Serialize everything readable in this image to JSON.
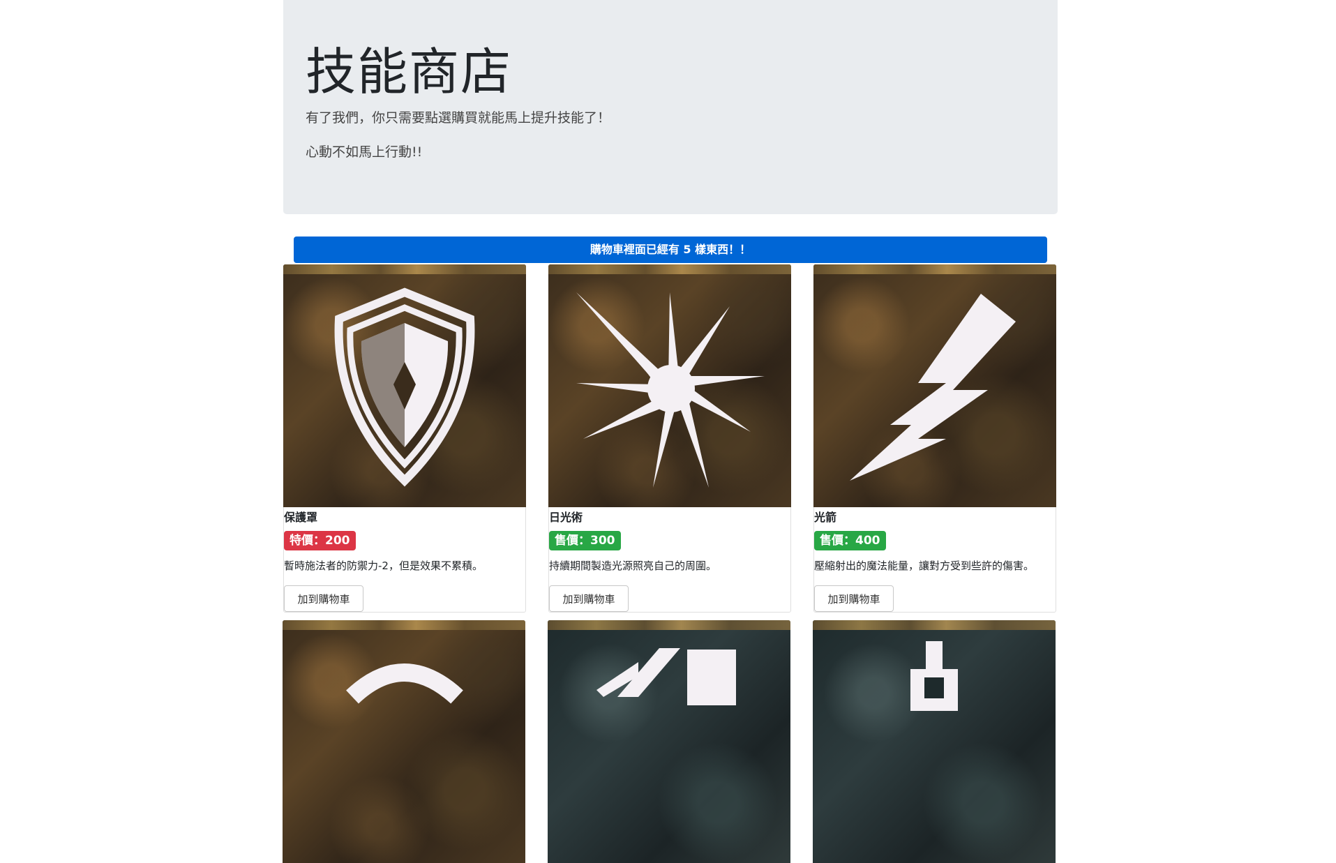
{
  "jumbotron": {
    "title": "技能商店",
    "lead1": "有了我們，你只需要點選購買就能馬上提升技能了！",
    "lead2": "心動不如馬上行動!!"
  },
  "cart_alert": "購物車裡面已經有 5 樣東西！！",
  "products": [
    {
      "name": "保護罩",
      "price_label": "特價：200",
      "price_style": "danger",
      "description": "暫時施法者的防禦力-2，但是效果不累積。",
      "button": "加到購物車",
      "icon": "shield-icon"
    },
    {
      "name": "日光術",
      "price_label": "售價：300",
      "price_style": "success",
      "description": "持續期間製造光源照亮自己的周圍。",
      "button": "加到購物車",
      "icon": "light-burst-icon"
    },
    {
      "name": "光箭",
      "price_label": "售價：400",
      "price_style": "success",
      "description": "壓縮射出的魔法能量，讓對方受到些許的傷害。",
      "button": "加到購物車",
      "icon": "lightning-bolt-icon"
    },
    {
      "icon": "skill-icon"
    },
    {
      "icon": "skill-icon"
    },
    {
      "icon": "skill-icon"
    }
  ],
  "colors": {
    "jumbotron_bg": "#e9ecef",
    "alert_bg": "#0066d6",
    "badge_danger": "#dc3545",
    "badge_success": "#28a745"
  }
}
